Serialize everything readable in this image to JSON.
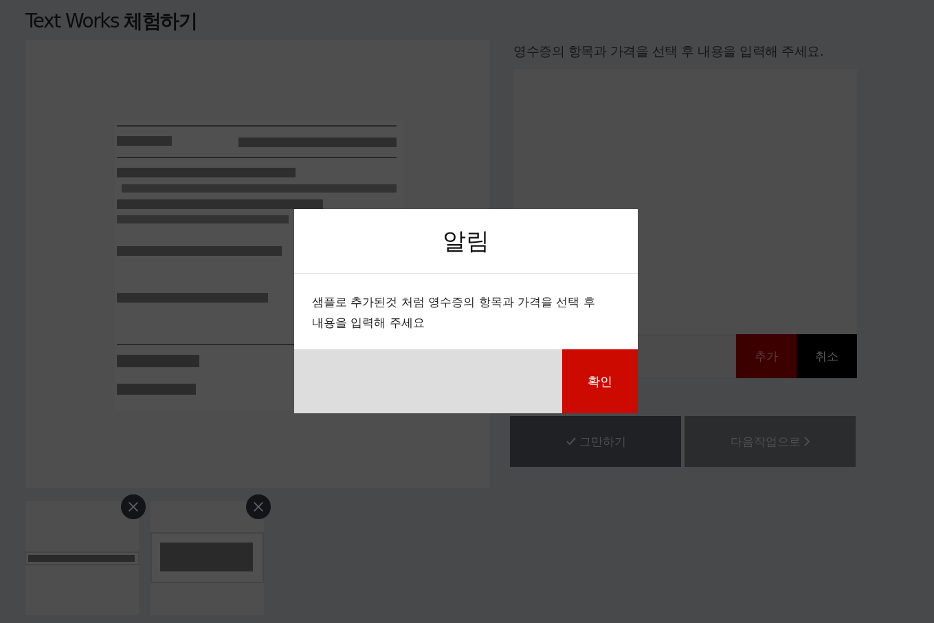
{
  "page": {
    "title": "Text Works **체험하기**"
  },
  "instruction": "영수증의 항목과 가격을 선택 후 내용을 입력해 주세요.",
  "entry": {
    "add_button": "추가",
    "cancel_button": "취소"
  },
  "actions": [
    {
      "label": "그만하기",
      "kind": "finish"
    },
    {
      "label": "다음작업으로",
      "kind": "next"
    }
  ],
  "dialog": {
    "title": "알림",
    "message": "샘플로 추가된것 처럼 영수증의 항목과 가격을 선택 후 내용을 입력해 주세요",
    "confirm_button": "확인"
  }
}
